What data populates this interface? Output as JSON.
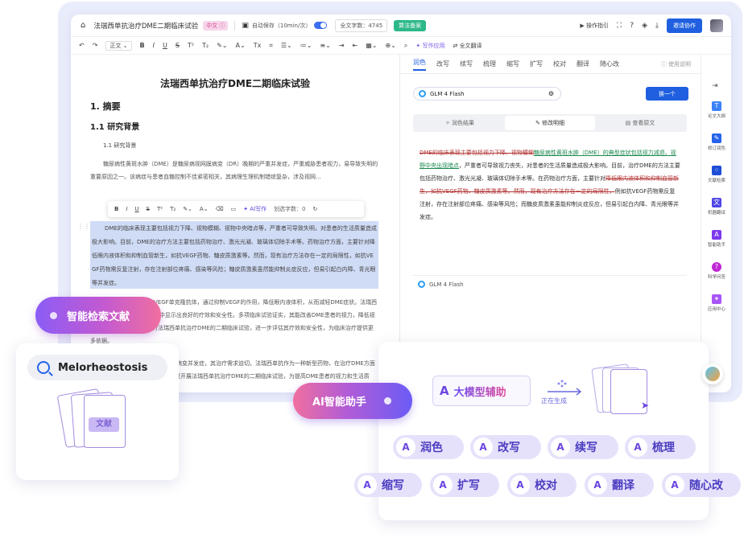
{
  "topbar": {
    "title": "法瑞西单抗治疗DME二期临床试验",
    "lang_badge": "中文 ⓘ",
    "autosave": "自动保存（10min/次）",
    "word_count": "全文字数：4745",
    "ai_check": "算法备案",
    "guide": "操作指引",
    "collab": "邀请协作"
  },
  "format_toolbar": {
    "style_select": "正文",
    "ai_apps": "写作应用",
    "translate": "全文翻译"
  },
  "document": {
    "title": "法瑞西单抗治疗DME二期临床试验",
    "h1": "1. 摘要",
    "h2": "1.1 研究背景",
    "h3": "1.1 研究背景",
    "para1": "糖尿病性黄斑水肿（DME）是糖尿病视网膜病变（DR）晚期的严重并发症，严重威胁患者视力，易导致失明的重要原因之一。该病症与患者血糖控制不佳紧密相关，其病理生理机制错综复杂，涉及视网...",
    "highlight": "DME的临床表现主要包括视力下降、视物模糊、视物中央暗点等，严重者可导致失明，对患者的生活质量造成极大影响。目前，DME的治疗方法主要包括药物治疗、激光光凝、玻璃体切除手术等。药物治疗方面，主要针对降低眼内液体积和抑制血管新生，如抗VEGF药物、糖皮质激素等。然而，现有治疗方法存在一定的局限性，如抗VEGF药物需反复注射，存在注射部位疼痛、感染等风险；糖皮质激素虽然能抑制炎症反应，但易引起白内障、青光眼等并发症。",
    "para2": "法瑞西单抗是一种抗VEGF单克隆抗体，通过抑制VEGF的作用，降低眼内液体积，从而减轻DME症状。法瑞西单抗在治疗DME的临床应用中显示出良好的疗效和安全性。多项临床试验证实，其能改善DME患者的视力，降低视力丧失的风险。因此，进行法瑞西单抗治疗DME的二期临床试验，进一步评估其疗效和安全性，为临床治疗提供更多依据。",
    "para3": "糖尿病性黄斑水肿导致视网膜病变并发症，其治疗需求迫切。法瑞西单抗作为一种新型药物，在治疗DME方面显示出巨大的潜力。本研究旨在通过开展法瑞西单抗治疗DME的二期临床试验，为提高DME患者的视力和生活质量。"
  },
  "float_toolbar": {
    "ai_write": "AI写作",
    "word_count": "划选字数：0"
  },
  "assistant": {
    "tabs": [
      "润色",
      "改写",
      "续写",
      "梳理",
      "缩写",
      "扩写",
      "校对",
      "翻译",
      "随心改"
    ],
    "help": "使用说明",
    "model": "GLM 4 Flash",
    "regen": "换一个",
    "seg": [
      "润色结果",
      "修改明细",
      "查看原文"
    ],
    "result_del_1": "DME的临床表现主要包括视力下降、视物模糊",
    "result_ins_1": "糖尿病性黄斑水肿（DME）的典型症状包括视力减退、视野中央出现暗点",
    "result_text_1": "，严重者可导致视力丧失，对患者的生活质量造成极大影响。目前，治疗DME的方法主要包括药物治疗、激光光凝、玻璃体切除手术等。在药物治疗方面，主要针对",
    "result_del_2": "降低眼内液体积和抑制血管新生，如抗VEGF药物、糖皮质激素等。然而，现有治疗方法存在一定的局限性，",
    "result_text_2": "例如抗VEGF药物需反复注射，存在注射部位疼痛、感染等风险；而糖皮质激素虽能抑制炎症反应，但易引起白内障、青光眼等并发症。",
    "model_tag": "GLM 4 Flash"
  },
  "rail": {
    "items": [
      "论文大纲",
      "修订润色",
      "文献检索",
      "机器翻译",
      "智能助手",
      "科学问答",
      "应用中心"
    ]
  },
  "overlays": {
    "search_pill": "智能检索文献",
    "search_query": "Melorheostosis",
    "docs_label": "文献",
    "ai_pill": "AI智能助手",
    "llm_label": "大模型辅助",
    "generating": "正在生成",
    "features_row1": [
      "润色",
      "改写",
      "续写",
      "梳理"
    ],
    "features_row2": [
      "缩写",
      "扩写",
      "校对",
      "翻译",
      "随心改"
    ]
  },
  "colors": {
    "primary": "#1f5fe0",
    "accent_purple": "#6b46e0",
    "highlight": "#d0dcf6"
  }
}
